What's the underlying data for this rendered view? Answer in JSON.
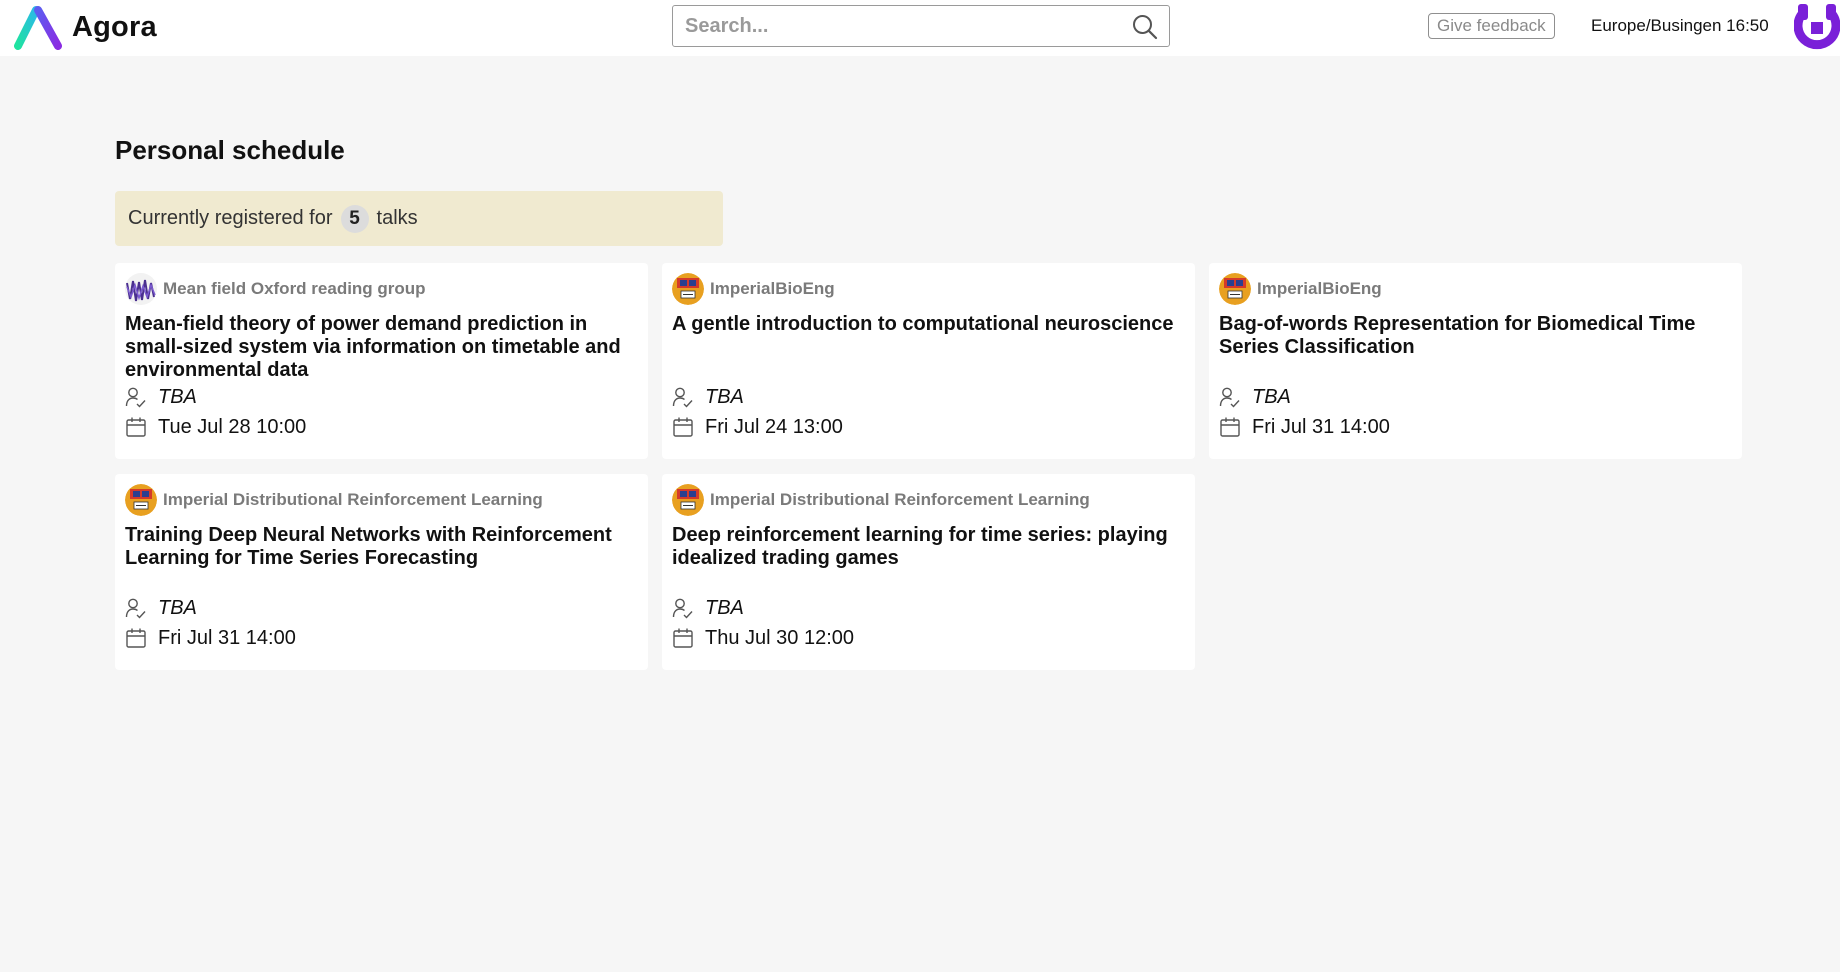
{
  "app": {
    "name": "Agora"
  },
  "search": {
    "placeholder": "Search..."
  },
  "header": {
    "feedback_label": "Give feedback",
    "timezone_clock": "Europe/Busingen 16:50"
  },
  "page": {
    "title": "Personal schedule",
    "registered_prefix": "Currently registered for",
    "registered_count": "5",
    "registered_suffix": "talks"
  },
  "colors": {
    "banner_bg": "#f0ead0",
    "accent_purple": "#7a20d8",
    "logo_green": "#1ee0a0"
  },
  "talks": [
    {
      "channel": "Mean field Oxford reading group",
      "channel_icon": "mean-field-icon",
      "title": "Mean-field theory of power demand prediction in small-sized system via information on timetable and environmental data",
      "speaker": "TBA",
      "date": "Tue Jul 28 10:00"
    },
    {
      "channel": "ImperialBioEng",
      "channel_icon": "imperial-crest-icon",
      "title": "A gentle introduction to computational neuroscience",
      "speaker": "TBA",
      "date": "Fri Jul 24 13:00"
    },
    {
      "channel": "ImperialBioEng",
      "channel_icon": "imperial-crest-icon",
      "title": "Bag-of-words Representation for Biomedical Time Series Classification",
      "speaker": "TBA",
      "date": "Fri Jul 31 14:00"
    },
    {
      "channel": "Imperial Distributional Reinforcement Learning",
      "channel_icon": "imperial-crest-icon",
      "title": "Training Deep Neural Networks with Reinforcement Learning for Time Series Forecasting",
      "speaker": "TBA",
      "date": "Fri Jul 31 14:00"
    },
    {
      "channel": "Imperial Distributional Reinforcement Learning",
      "channel_icon": "imperial-crest-icon",
      "title": "Deep reinforcement learning for time series: playing idealized trading games",
      "speaker": "TBA",
      "date": "Thu Jul 30 12:00"
    }
  ]
}
